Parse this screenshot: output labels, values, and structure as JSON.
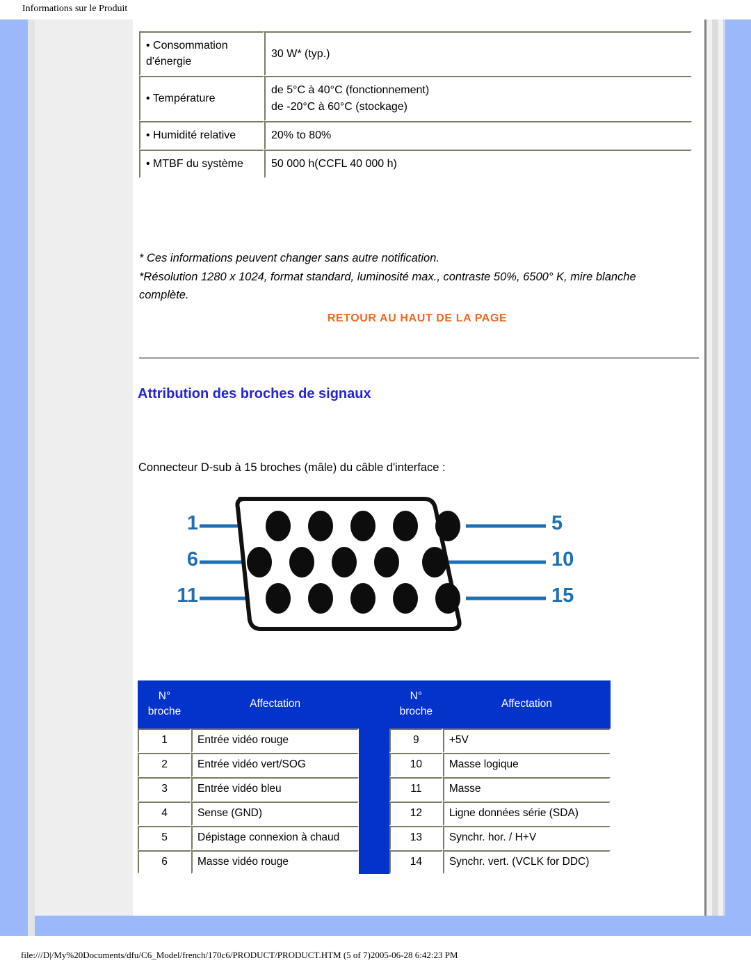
{
  "header": {
    "title": "Informations sur le Produit"
  },
  "footer": {
    "path": "file:///D|/My%20Documents/dfu/C6_Model/french/170c6/PRODUCT/PRODUCT.HTM (5 of 7)2005-06-28 6:42:23 PM"
  },
  "colors": {
    "page_frame_blue": "#9ab8fa",
    "sidebar_gray": "#eeeeee",
    "table_header_blue": "#0433cc",
    "link_orange": "#f4661e",
    "heading_blue": "#2222dd",
    "pin_label_blue": "#1f6fb5"
  },
  "spec_table": {
    "rows": [
      {
        "key": "• Consommation d'énergie",
        "value": "30 W* (typ.)"
      },
      {
        "key": "• Température",
        "value": "de 5°C à 40°C (fonctionnement)\nde -20°C à 60°C (stockage)"
      },
      {
        "key": "• Humidité relative",
        "value": "20% to 80%"
      },
      {
        "key": "• MTBF du système",
        "value": "50 000 h(CCFL 40 000 h)"
      }
    ]
  },
  "notes": {
    "line1": "* Ces informations peuvent changer sans autre notification.",
    "line2": "*Résolution 1280 x 1024, format standard, luminosité max., contraste 50%, 6500° K, mire blanche complète."
  },
  "back_link": {
    "label": "RETOUR AU HAUT DE LA PAGE"
  },
  "section": {
    "heading": "Attribution des broches de signaux",
    "caption": "Connecteur D-sub à 15 broches (mâle) du câble d'interface :"
  },
  "connector_diagram": {
    "labels_left": [
      "1",
      "6",
      "11"
    ],
    "labels_right": [
      "5",
      "10",
      "15"
    ],
    "rows": 3,
    "pins_per_row": 5,
    "total_pins": 15
  },
  "pin_table": {
    "headers": {
      "num": "N° broche",
      "assign": "Affectation"
    },
    "left_rows": [
      {
        "pin": "1",
        "assign": "Entrée vidéo rouge"
      },
      {
        "pin": "2",
        "assign": "Entrée vidéo vert/SOG"
      },
      {
        "pin": "3",
        "assign": "Entrée vidéo bleu"
      },
      {
        "pin": "4",
        "assign": "Sense (GND)"
      },
      {
        "pin": "5",
        "assign": "Dépistage connexion à chaud"
      },
      {
        "pin": "6",
        "assign": "Masse vidéo rouge"
      }
    ],
    "right_rows": [
      {
        "pin": "9",
        "assign": "+5V"
      },
      {
        "pin": "10",
        "assign": "Masse logique"
      },
      {
        "pin": "11",
        "assign": "Masse"
      },
      {
        "pin": "12",
        "assign": "Ligne données série (SDA)"
      },
      {
        "pin": "13",
        "assign": "Synchr. hor. / H+V"
      },
      {
        "pin": "14",
        "assign": "Synchr. vert. (VCLK for DDC)"
      }
    ]
  }
}
